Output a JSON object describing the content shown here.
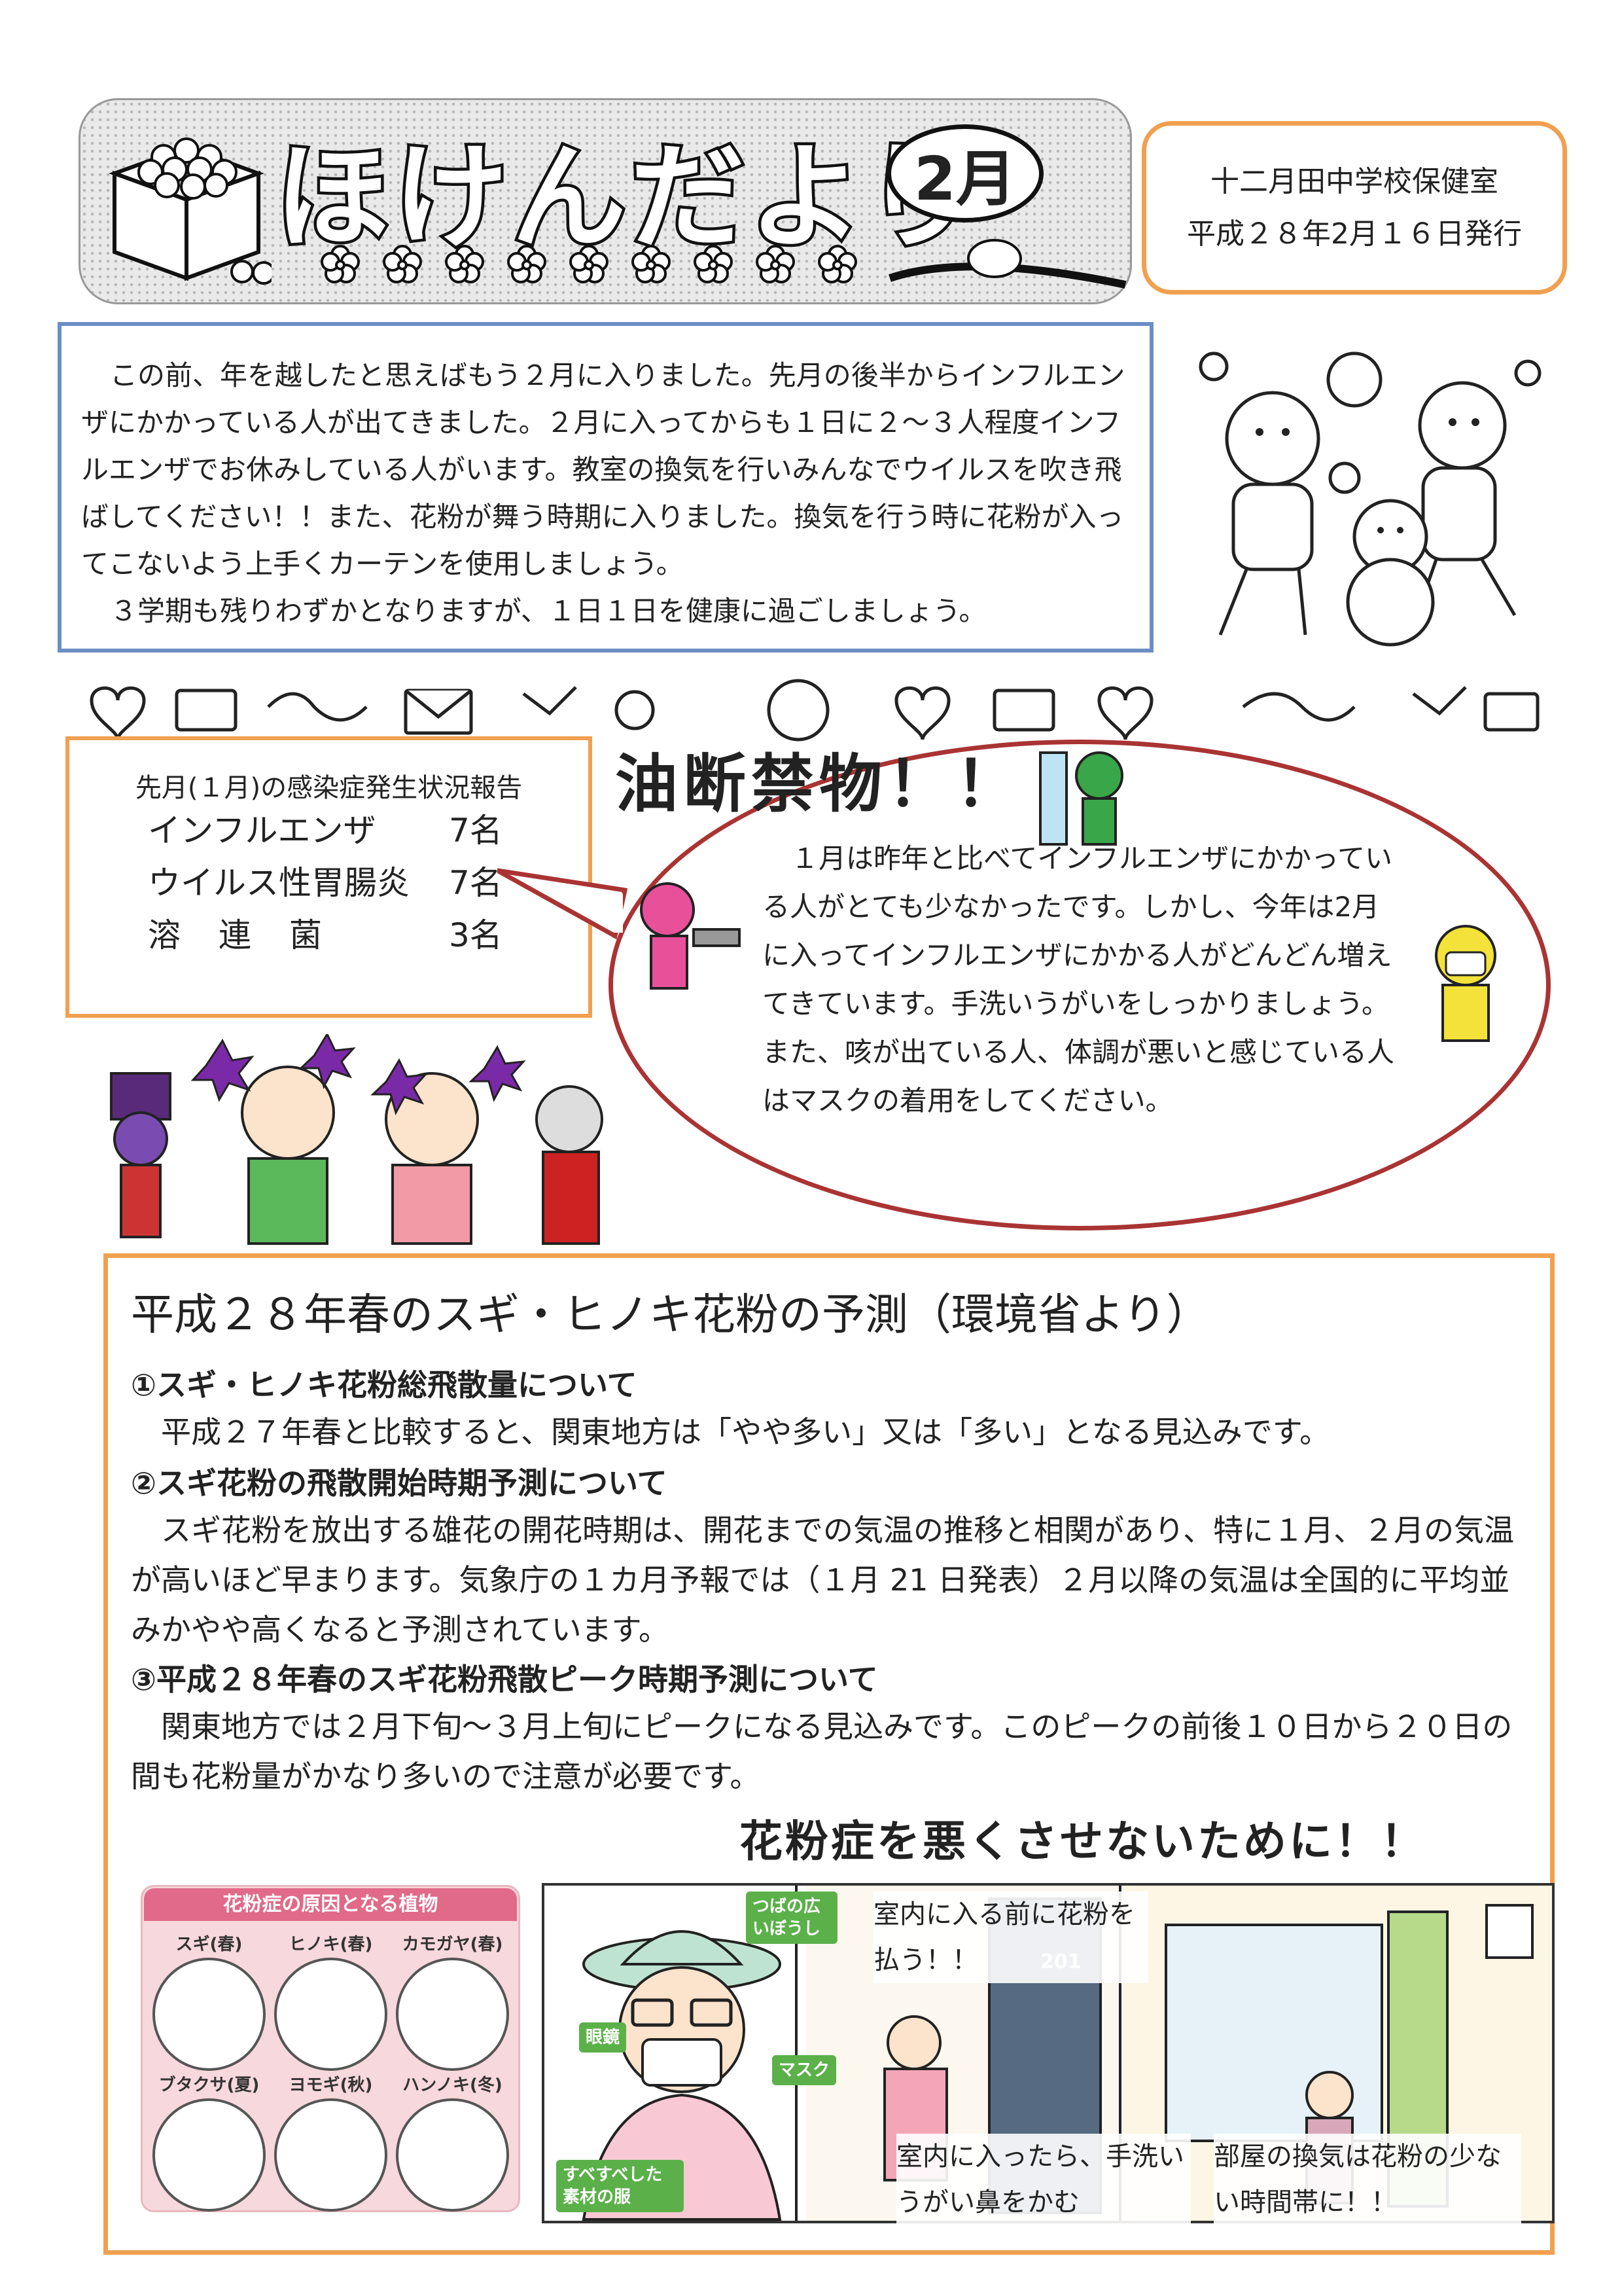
{
  "header": {
    "title": "ほけんだより",
    "month": "2月",
    "issuer": "十二月田中学校保健室",
    "date": "平成２８年2月１６日発行"
  },
  "intro": {
    "paragraph1": "この前、年を越したと思えばもう２月に入りました。先月の後半からインフルエンザにかかっている人が出てきました。２月に入ってからも１日に２～３人程度インフルエンザでお休みしている人がいます。教室の換気を行いみんなでウイルスを吹き飛ばしてください！！また、花粉が舞う時期に入りました。換気を行う時に花粉が入ってこないよう上手くカーテンを使用しましょう。",
    "paragraph2": "３学期も残りわずかとなりますが、１日１日を健康に過ごしましょう。"
  },
  "infection_report": {
    "title": "先月(１月)の感染症発生状況報告",
    "rows": [
      {
        "name": "インフルエンザ",
        "count": "7名"
      },
      {
        "name": "ウイルス性胃腸炎",
        "count": "7名"
      },
      {
        "name": "溶連菌",
        "count": "3名"
      }
    ]
  },
  "warning": {
    "headline": "油断禁物！！",
    "text": "１月は昨年と比べてインフルエンザにかかっている人がとても少なかったです。しかし、今年は2月に入ってインフルエンザにかかる人がどんどん増えてきています。手洗いうがいをしっかりましょう。また、咳が出ている人、体調が悪いと感じている人はマスクの着用をしてください。"
  },
  "pollen": {
    "title": "平成２８年春のスギ・ヒノキ花粉の予測（環境省より）",
    "sections": [
      {
        "heading": "①スギ・ヒノキ花粉総飛散量について",
        "body": "平成２７年春と比較すると、関東地方は「やや多い」又は「多い」となる見込みです。"
      },
      {
        "heading": "②スギ花粉の飛散開始時期予測について",
        "body": "スギ花粉を放出する雄花の開花時期は、開花までの気温の推移と相関があり、特に１月、２月の気温が高いほど早まります。気象庁の１カ月予報では（１月 21 日発表）２月以降の気温は全国的に平均並みかやや高くなると予測されています。"
      },
      {
        "heading": "③平成２８年春のスギ花粉飛散ピーク時期予測について",
        "body": "関東地方では２月下旬～３月上旬にピークになる見込みです。このピークの前後１０日から２０日の間も花粉量がかなり多いので注意が必要です。"
      }
    ],
    "prevent_title": "花粉症を悪くさせないために！！"
  },
  "plants": {
    "title": "花粉症の原因となる植物",
    "items": [
      "スギ(春)",
      "ヒノキ(春)",
      "カモガヤ(春)",
      "ブタクサ(夏)",
      "ヨモギ(秋)",
      "ハンノキ(冬)"
    ]
  },
  "illustration": {
    "tags": {
      "hat": "つばの広いぼうし",
      "glasses": "眼鏡",
      "mask": "マスク",
      "clothes": "すべすべした素材の服"
    },
    "panel2_top": "室内に入る前に花粉を払う！！",
    "panel2_bottom": "室内に入ったら、手洗いうがい鼻をかむ",
    "panel3_bottom": "部屋の換気は花粉の少ない時間帯に！！",
    "door_number": "201"
  }
}
